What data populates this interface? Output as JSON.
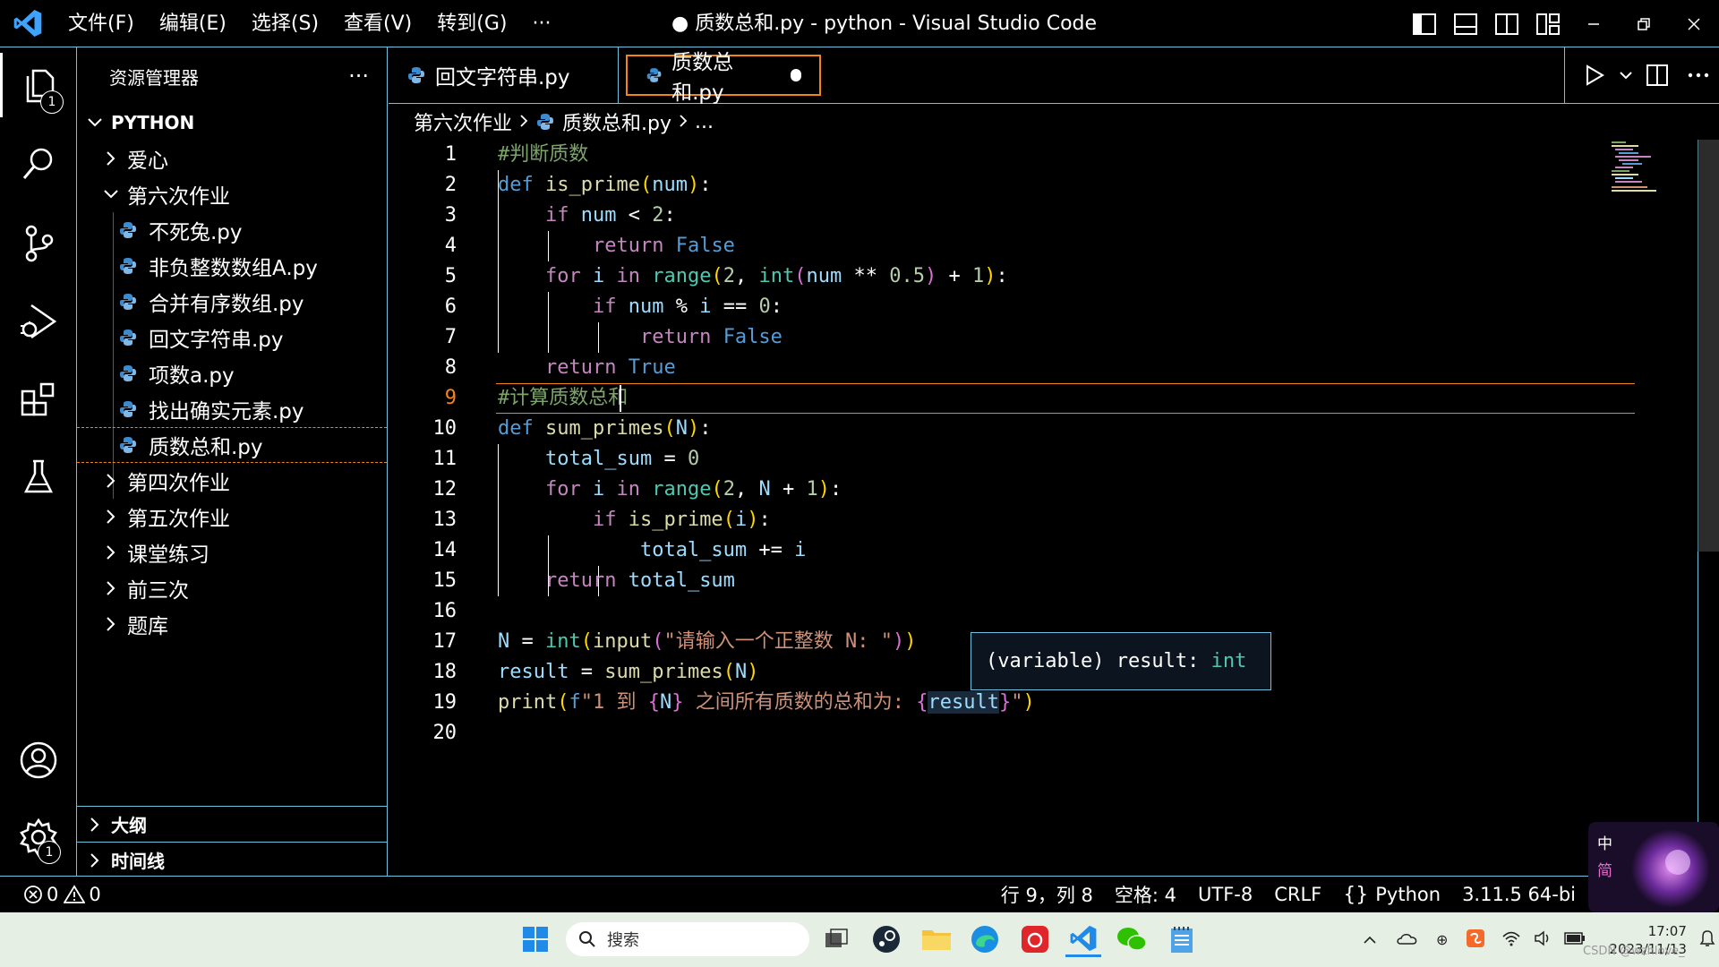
{
  "window": {
    "title": "● 质数总和.py - python - Visual Studio Code",
    "menu": [
      "文件(F)",
      "编辑(E)",
      "选择(S)",
      "查看(V)",
      "转到(G)",
      "···"
    ]
  },
  "activity_bar": {
    "explorer_badge": "1",
    "settings_badge": "1"
  },
  "sidebar": {
    "header": "资源管理器",
    "more": "···",
    "root": "PYTHON",
    "tree": [
      {
        "label": "爱心",
        "type": "folder",
        "expanded": false
      },
      {
        "label": "第六次作业",
        "type": "folder",
        "expanded": true
      },
      {
        "label": "不死兔.py",
        "type": "file"
      },
      {
        "label": "非负整数数组A.py",
        "type": "file"
      },
      {
        "label": "合并有序数组.py",
        "type": "file"
      },
      {
        "label": "回文字符串.py",
        "type": "file"
      },
      {
        "label": "项数a.py",
        "type": "file"
      },
      {
        "label": "找出确实元素.py",
        "type": "file"
      },
      {
        "label": "质数总和.py",
        "type": "file",
        "selected": true
      },
      {
        "label": "第四次作业",
        "type": "folder",
        "expanded": false
      },
      {
        "label": "第五次作业",
        "type": "folder",
        "expanded": false
      },
      {
        "label": "课堂练习",
        "type": "folder",
        "expanded": false
      },
      {
        "label": "前三次",
        "type": "folder",
        "expanded": false
      },
      {
        "label": "题库",
        "type": "folder",
        "expanded": false
      }
    ],
    "outline": "大纲",
    "timeline": "时间线"
  },
  "tabs": [
    {
      "label": "回文字符串.py",
      "active": false
    },
    {
      "label": "质数总和.py",
      "active": true,
      "dirty": true
    }
  ],
  "breadcrumb": {
    "folder": "第六次作业",
    "file": "质数总和.py",
    "more": "..."
  },
  "editor": {
    "current_line": 9,
    "line_numbers": [
      "1",
      "2",
      "3",
      "4",
      "5",
      "6",
      "7",
      "8",
      "9",
      "10",
      "11",
      "12",
      "13",
      "14",
      "15",
      "16",
      "17",
      "18",
      "19",
      "20"
    ],
    "hover_prefix": "(variable) result: ",
    "hover_type": "int"
  },
  "statusbar": {
    "errors": "0",
    "warnings": "0",
    "position": "行 9，列 8",
    "spaces": "空格: 4",
    "encoding": "UTF-8",
    "eol": "CRLF",
    "language": "Python",
    "interpreter": "3.11.5 64-bi"
  },
  "ime": {
    "lang": "中",
    "mode": "简"
  },
  "taskbar": {
    "search_placeholder": "搜索",
    "time": "17:07",
    "date": "2023/11/13",
    "watermark": "CSDN @wzhlove_"
  },
  "colors": {
    "contrast_border": "#6fc3df",
    "active_border": "#f38518",
    "keyword": "#569cd6",
    "function": "#dcdcaa",
    "comment": "#7ca668",
    "string": "#ce9178",
    "number": "#b5cea8"
  }
}
